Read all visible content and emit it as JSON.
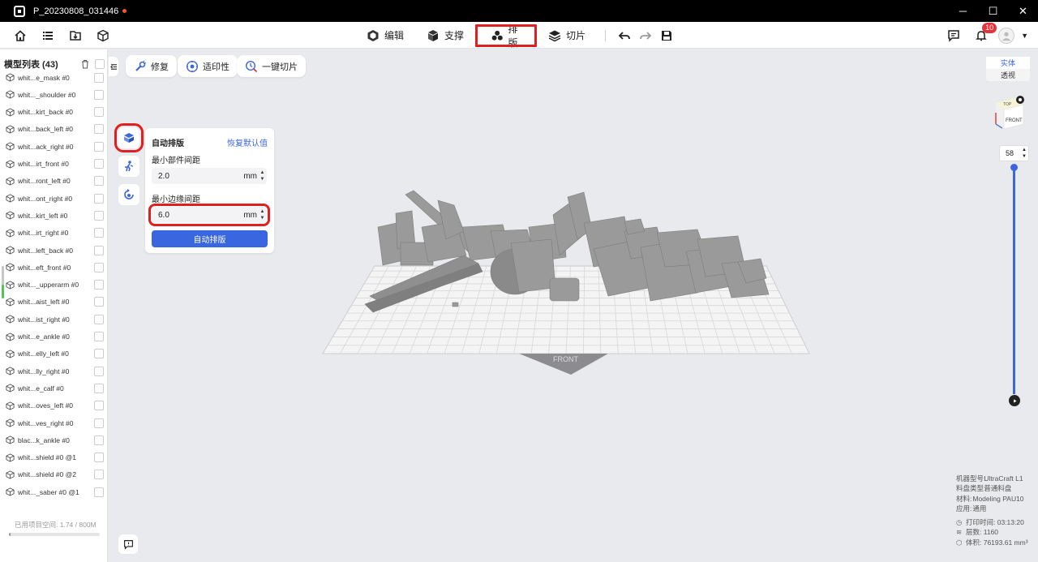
{
  "window": {
    "title": "P_20230808_031446",
    "controls": {
      "minimize": "─",
      "maximize": "☐",
      "close": "✕"
    }
  },
  "toolbar": {
    "modes": [
      {
        "label": "编辑",
        "icon": "edit-cube-icon"
      },
      {
        "label": "支撑",
        "icon": "support-icon"
      },
      {
        "label": "排版",
        "icon": "arrange-icon",
        "active": true
      },
      {
        "label": "切片",
        "icon": "slice-layers-icon"
      }
    ],
    "notifications": "10"
  },
  "sidebar": {
    "title": "模型列表 (43)",
    "items": [
      "whit...e_mask #0",
      "whit..._shoulder #0",
      "whit...kirt_back #0",
      "whit...back_left #0",
      "whit...ack_right #0",
      "whit...irt_front #0",
      "whit...ront_left #0",
      "whit...ont_right #0",
      "whit...kirt_left #0",
      "whit...irt_right #0",
      "whit...left_back #0",
      "whit...eft_front #0",
      "whit..._upperarm #0",
      "whit...aist_left #0",
      "whit...ist_right #0",
      "whit...e_ankle #0",
      "whit...elly_left #0",
      "whit...lly_right #0",
      "whit...e_calf #0",
      "whit...oves_left #0",
      "whit...ves_right #0",
      "blac...k_ankle #0",
      "whit...shield #0 @1",
      "whit...shield #0 @2",
      "whit..._saber #0 @1"
    ],
    "storage": "已用项目空间: 1.74 / 800M",
    "storage_fraction": 0.002
  },
  "actions": {
    "repair": "修复",
    "printability": "适印性",
    "one_click_slice": "一键切片"
  },
  "arrange_panel": {
    "title": "自动排版",
    "reset": "恢复默认值",
    "min_part_spacing_label": "最小部件间距",
    "min_part_spacing_value": "2.0",
    "min_edge_spacing_label": "最小边缘间距",
    "min_edge_spacing_value": "6.0",
    "unit": "mm",
    "button": "自动排版"
  },
  "viewport": {
    "view_modes": [
      "实体",
      "透视"
    ],
    "cube_labels": {
      "top": "TOP",
      "front": "FRONT"
    },
    "plate_label": "FRONT",
    "layer": "58"
  },
  "info": {
    "machine_label": "机器型号:",
    "machine": "UltraCraft L1",
    "tray_label": "料盘类型:",
    "tray": "普通料盘",
    "material_label": "材料:",
    "material": "Modeling PAU10",
    "apply_label": "应用:",
    "apply": "通用",
    "print_time": "打印时间: 03:13:20",
    "layers": "层数: 1160",
    "volume": "体积: 76193.61 mm³"
  },
  "colors": {
    "accent": "#3a66e0",
    "highlight": "#e02020",
    "badge": "#e5333a",
    "model_grey": "#9a9a9a"
  }
}
